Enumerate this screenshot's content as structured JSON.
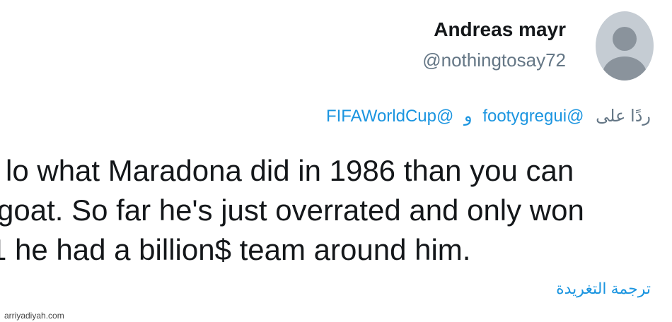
{
  "author": {
    "display_name": "Andreas mayr",
    "handle": "@nothingtosay72",
    "avatar_icon": "default-profile-icon"
  },
  "reply": {
    "prefix": "ردًا على",
    "mention_1": "@footygregui",
    "separator": "و",
    "mention_2": "@FIFAWorldCup"
  },
  "tweet": {
    "lines": [
      "lo what Maradona did in 1986 than you can",
      "goat. So far he's just overrated and only won",
      "1 he had a billion$ team around him."
    ]
  },
  "translate_label": "ترجمة التغريدة",
  "watermark": "arriyadiyah.com",
  "colors": {
    "link": "#1b95e0",
    "secondary_text": "#657786",
    "primary_text": "#14171a",
    "avatar_bg": "#c5ccd3"
  }
}
